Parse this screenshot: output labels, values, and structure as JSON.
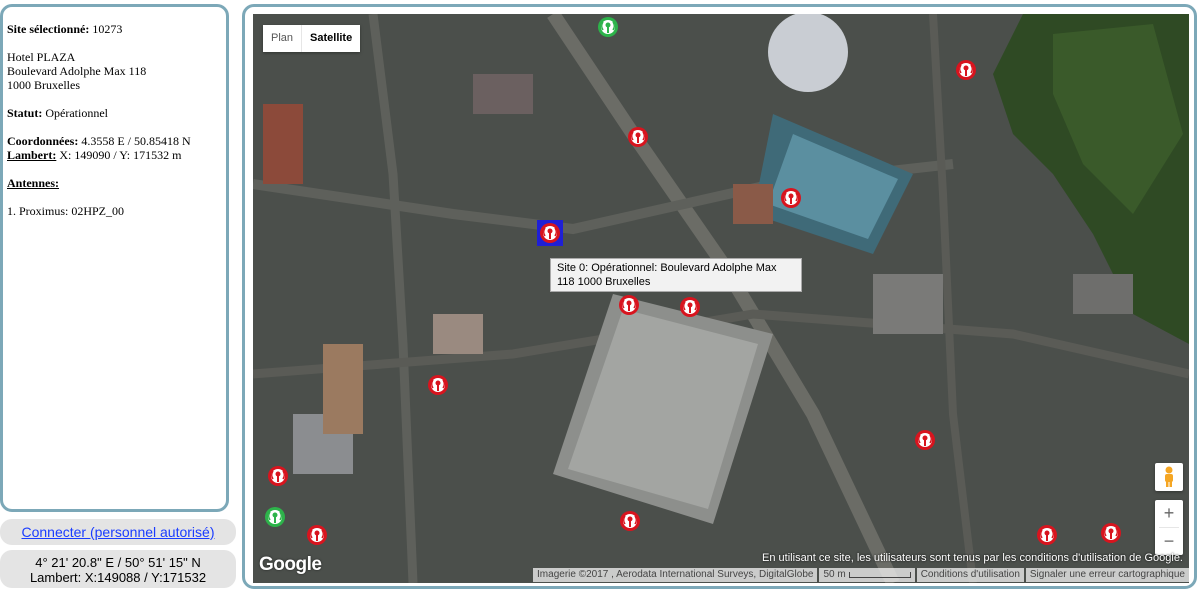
{
  "info": {
    "site_label": "Site sélectionné:",
    "site_id": "10273",
    "address_name": "Hotel PLAZA",
    "address_street": "Boulevard Adolphe Max 118",
    "address_city": "1000 Bruxelles",
    "status_label": "Statut:",
    "status_value": "Opérationnel",
    "coords_label": "Coordonnées:",
    "coords_value": "4.3558 E / 50.85418 N",
    "lambert_label": "Lambert:",
    "lambert_value": "X: 149090 / Y: 171532 m",
    "antennas_label": "Antennes:",
    "antennas": [
      "1. Proximus: 02HPZ_00"
    ]
  },
  "connect_label": "Connecter (personnel autorisé)",
  "cursor_coords": {
    "dms": "4° 21' 20.8\" E / 50° 51' 15\" N",
    "lambert": "Lambert: X:149088 / Y:171532"
  },
  "map": {
    "type_plan": "Plan",
    "type_satellite": "Satellite",
    "selected_type": "Satellite",
    "tooltip_line1": "Site 0: Opérationnel: Boulevard Adolphe Max",
    "tooltip_line2": "118 1000 Bruxelles",
    "zoom_in": "+",
    "zoom_out": "−",
    "logo": "Google",
    "terms_notice": "En utilisant ce site, les utilisateurs sont tenus par les conditions d'utilisation de Google.",
    "imagery_credit": "Imagerie ©2017 , Aerodata International Surveys, DigitalGlobe",
    "scale_label": "50 m",
    "terms_link": "Conditions d'utilisation",
    "report_link": "Signaler une erreur cartographique",
    "marker_colors": {
      "antenna": "#d8141e",
      "green": "#2db34a",
      "selected_border": "#1f1fd6"
    }
  }
}
